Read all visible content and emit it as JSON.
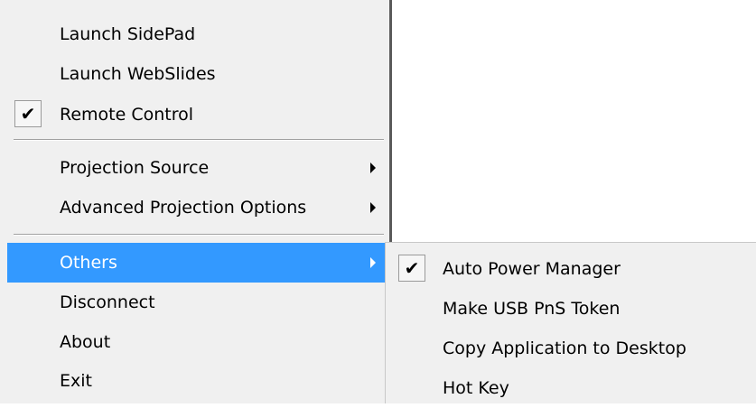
{
  "main_menu": {
    "items": [
      {
        "label": "Launch SidePad"
      },
      {
        "label": "Launch WebSlides"
      },
      {
        "label": "Remote Control",
        "checked": true,
        "check_glyph": "✔"
      },
      {
        "label": "Projection Source",
        "has_submenu": true
      },
      {
        "label": "Advanced Projection Options",
        "has_submenu": true
      },
      {
        "label": "Others",
        "has_submenu": true,
        "selected": true
      },
      {
        "label": "Disconnect"
      },
      {
        "label": "About"
      },
      {
        "label": "Exit"
      }
    ]
  },
  "sub_menu": {
    "items": [
      {
        "label": "Auto Power Manager",
        "checked": true,
        "check_glyph": "✔"
      },
      {
        "label": "Make USB PnS Token"
      },
      {
        "label": "Copy Application to Desktop"
      },
      {
        "label": "Hot Key"
      }
    ]
  },
  "colors": {
    "menu_bg": "#f0f0f0",
    "highlight": "#3399ff",
    "highlight_text": "#ffffff",
    "shadow": "#5a5a5a"
  }
}
